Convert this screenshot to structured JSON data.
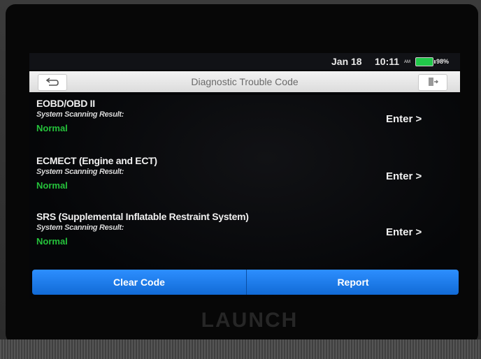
{
  "status_bar": {
    "date": "Jan 18",
    "time": "10:11",
    "ampm": "AM",
    "battery_percent": "98%",
    "battery_level": 0.98,
    "battery_color": "#21c84a"
  },
  "header": {
    "title": "Diagnostic Trouble Code",
    "back_icon": "back-arrow-icon",
    "exit_icon": "exit-icon"
  },
  "systems": [
    {
      "name": "EOBD/OBD II",
      "result_label": "System Scanning Result:",
      "result": "Normal",
      "action": "Enter >"
    },
    {
      "name": "ECMECT (Engine and ECT)",
      "result_label": "System Scanning Result:",
      "result": "Normal",
      "action": "Enter >"
    },
    {
      "name": "SRS (Supplemental Inflatable Restraint System)",
      "result_label": "System Scanning Result:",
      "result": "Normal",
      "action": "Enter >"
    }
  ],
  "footer": {
    "clear_label": "Clear Code",
    "report_label": "Report"
  },
  "device": {
    "brand": "LAUNCH"
  },
  "colors": {
    "status_normal": "#25c23b",
    "accent": "#1f7ff0"
  }
}
